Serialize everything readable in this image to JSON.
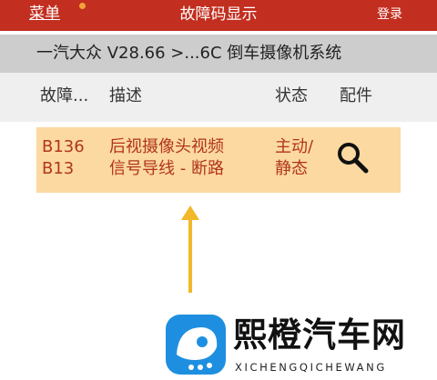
{
  "header": {
    "menu_label": "菜单",
    "title": "故障码显示",
    "login_label": "登录"
  },
  "breadcrumb": "一汽大众 V28.66 >...6C 倒车摄像机系统",
  "table": {
    "columns": [
      "故障...",
      "描述",
      "状态",
      "配件"
    ],
    "rows": [
      {
        "code": "B136\nB13",
        "description": "后视摄像头视频\n信号导线 - 断路",
        "status": "主动/\n静态"
      }
    ]
  },
  "watermark": {
    "name": "熙橙汽车网",
    "sub": "XICHENGQICHEWANG"
  },
  "colors": {
    "header": "#c22e1f",
    "row_highlight": "#fcd9a0",
    "row_text": "#b1351c",
    "arrow": "#f0b82a",
    "logo": "#1e8fe0"
  },
  "icons": {
    "row_action": "search-icon",
    "arrow": "arrow-up-icon",
    "logo": "logo-icon"
  }
}
